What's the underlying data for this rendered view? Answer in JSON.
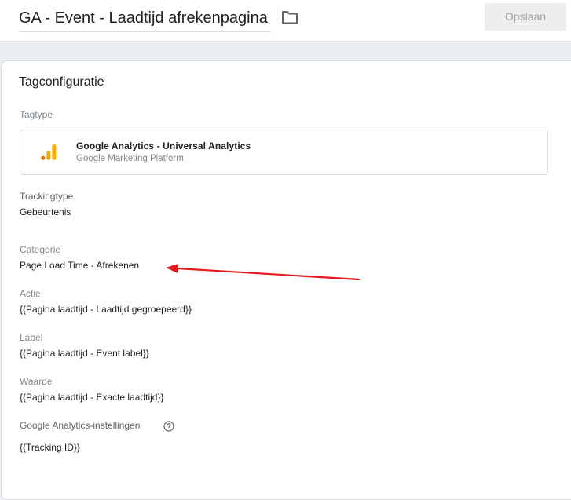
{
  "header": {
    "tag_name": "GA - Event - Laadtijd afrekenpagina",
    "save_label": "Opslaan"
  },
  "config": {
    "title": "Tagconfiguratie",
    "tagtype_label": "Tagtype",
    "tagtype_name": "Google Analytics - Universal Analytics",
    "tagtype_sub": "Google Marketing Platform",
    "tracking_type_label": "Trackingtype",
    "tracking_type_value": "Gebeurtenis",
    "category_label": "Categorie",
    "category_value": "Page Load Time - Afrekenen",
    "action_label": "Actie",
    "action_value": "{{Pagina laadtijd - Laadtijd gegroepeerd}}",
    "event_label_label": "Label",
    "event_label_value": "{{Pagina laadtijd - Event label}}",
    "value_label": "Waarde",
    "value_value": "{{Pagina laadtijd - Exacte laadtijd}}",
    "ga_settings_label": "Google Analytics-instellingen",
    "ga_settings_value": "{{Tracking ID}}"
  },
  "icons": {
    "folder": "folder-icon",
    "analytics": "google-analytics-icon",
    "help": "help-icon"
  },
  "colors": {
    "annotation_arrow": "#e8171c",
    "ga_orange": "#f9ab00",
    "ga_dark_orange": "#e37400"
  }
}
